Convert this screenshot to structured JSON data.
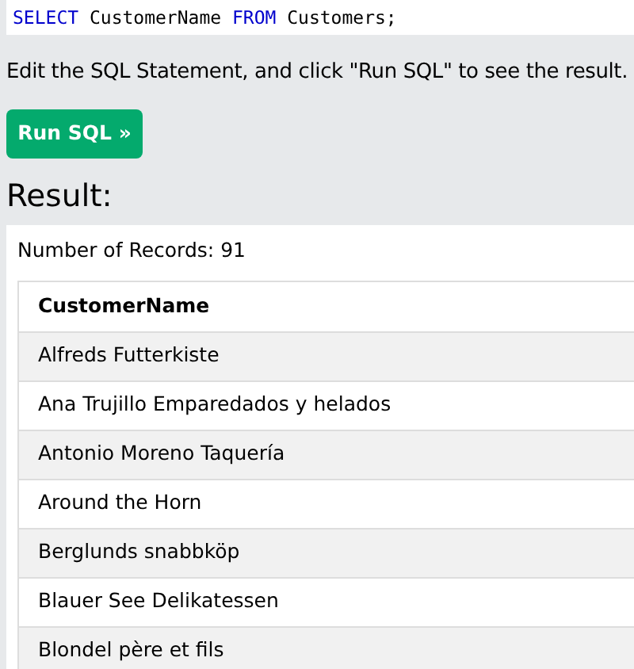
{
  "query": [
    {
      "text": "SELECT",
      "kind": "keyword"
    },
    {
      "text": " CustomerName ",
      "kind": "plain"
    },
    {
      "text": "FROM",
      "kind": "keyword"
    },
    {
      "text": " Customers;",
      "kind": "plain"
    }
  ],
  "instruction": "Edit the SQL Statement, and click \"Run SQL\" to see the result.",
  "run_button": "Run SQL »",
  "result_heading": "Result:",
  "record_count": "Number of Records: 91",
  "table": {
    "columns": [
      "CustomerName"
    ],
    "rows": [
      [
        "Alfreds Futterkiste"
      ],
      [
        "Ana Trujillo Emparedados y helados"
      ],
      [
        "Antonio Moreno Taquería"
      ],
      [
        "Around the Horn"
      ],
      [
        "Berglunds snabbköp"
      ],
      [
        "Blauer See Delikatessen"
      ],
      [
        "Blondel père et fils"
      ]
    ]
  }
}
